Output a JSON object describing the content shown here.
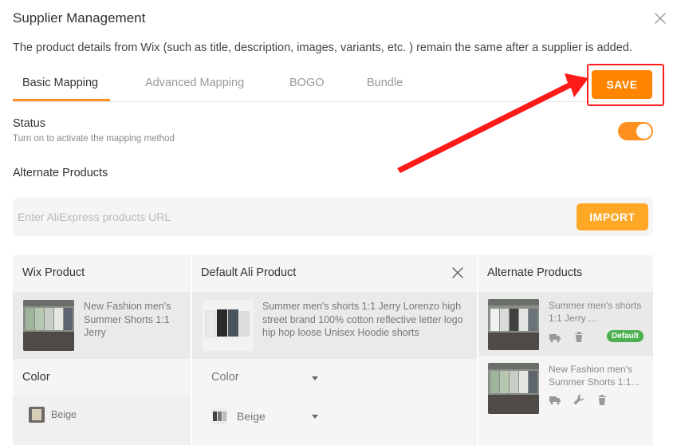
{
  "dialog": {
    "title": "Supplier Management",
    "description": "The product details from Wix (such as title, description, images, variants, etc. ) remain the same after a supplier is added."
  },
  "tabs": [
    {
      "label": "Basic Mapping",
      "active": true
    },
    {
      "label": "Advanced Mapping",
      "active": false
    },
    {
      "label": "BOGO",
      "active": false
    },
    {
      "label": "Bundle",
      "active": false
    }
  ],
  "save_label": "SAVE",
  "status": {
    "title": "Status",
    "subtitle": "Turn on to activate the mapping method",
    "enabled": true
  },
  "alternate_products_title": "Alternate Products",
  "url_input": {
    "placeholder": "Enter AliExpress products URL",
    "value": ""
  },
  "import_label": "IMPORT",
  "table": {
    "wix_header": "Wix Product",
    "ali_header": "Default Ali Product",
    "alt_header": "Alternate Products",
    "wix_product_name": "New Fashion men's Summer Shorts 1:1 Jerry",
    "ali_product_name": "Summer men's shorts 1:1 Jerry Lorenzo high street brand 100% cotton reflective letter logo hip hop loose Unisex Hoodie shorts",
    "wix_option_name": "Color",
    "wix_option_value": "Beige",
    "ali_option_name": "Color",
    "ali_option_value": "Beige",
    "alternates": [
      {
        "name": "Summer men's shorts 1:1 Jerry ...",
        "badge": "Default"
      },
      {
        "name": "New Fashion men's Summer Shorts 1:1...",
        "badge": ""
      }
    ]
  },
  "colors": {
    "accent": "#ff8f1f",
    "save_button": "#ff8400",
    "import_button": "#ffa726",
    "annotation_red": "#ff1e1e",
    "badge_green": "#4caf50"
  },
  "icons": [
    "close-icon",
    "truck-icon",
    "trash-icon",
    "wrench-icon",
    "caret-down-icon"
  ]
}
